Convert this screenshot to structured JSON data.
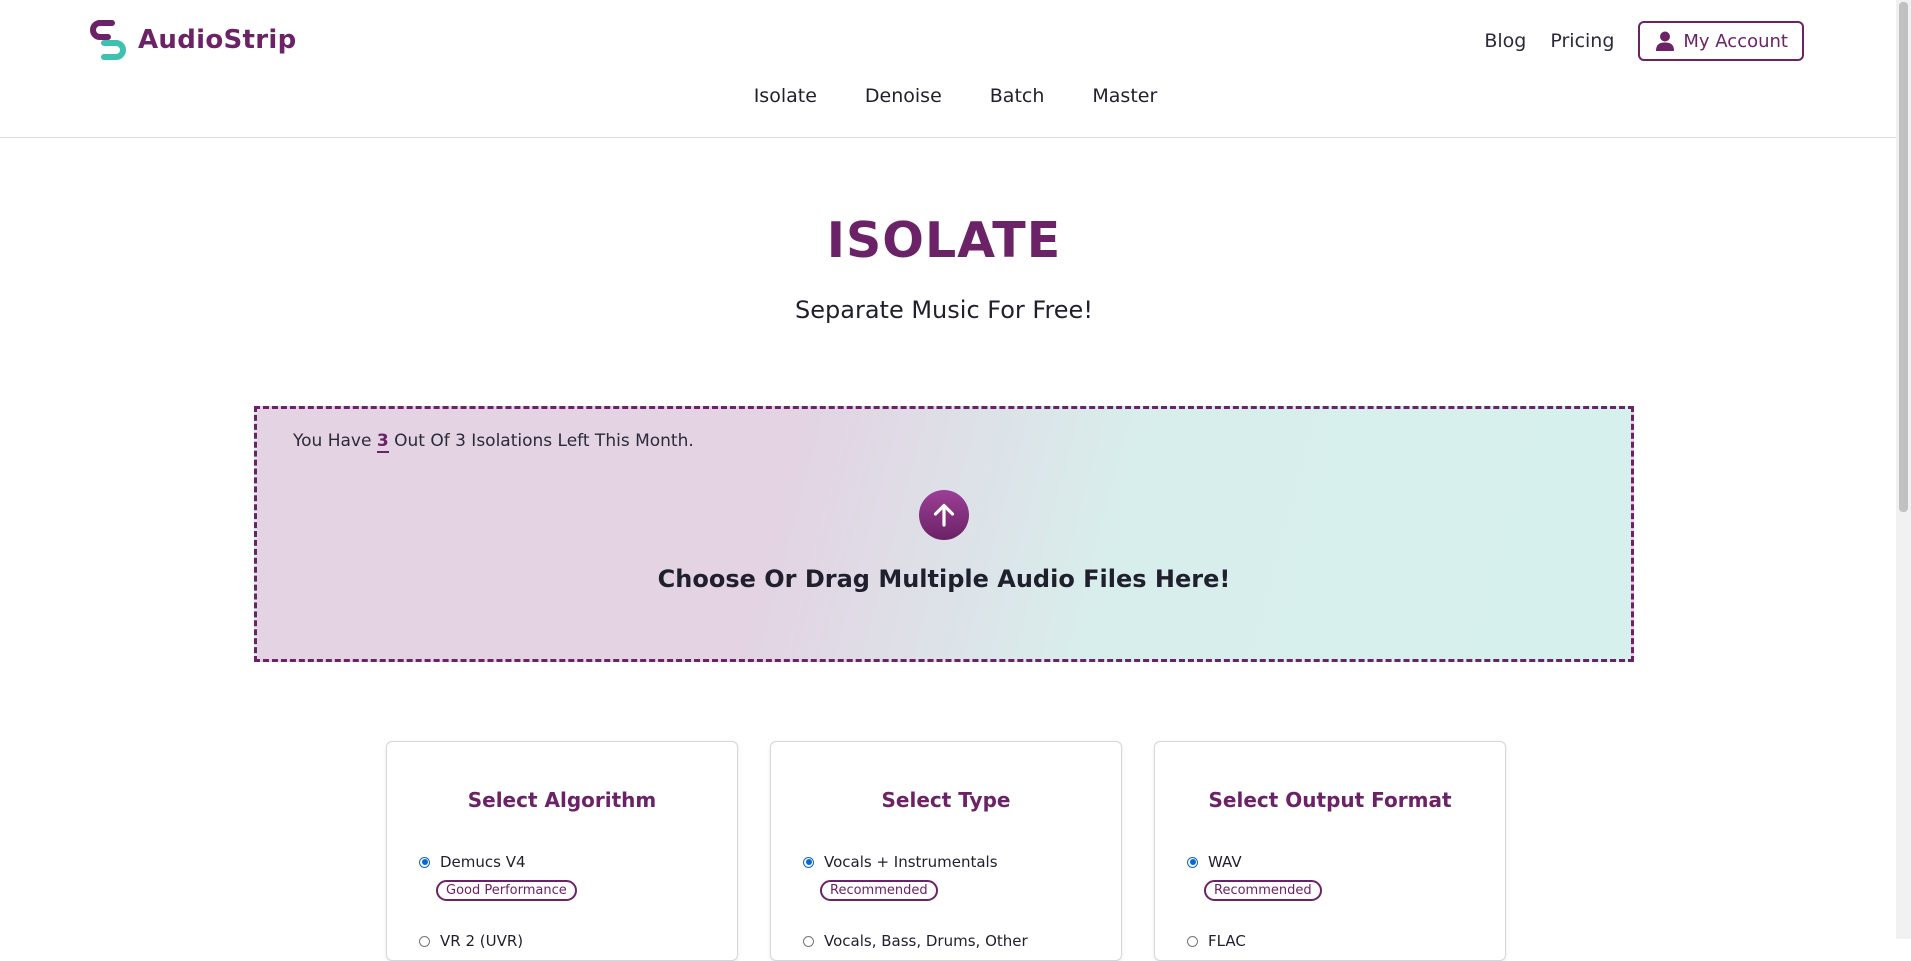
{
  "brand": {
    "name": "AudioStrip",
    "colors": {
      "primary": "#6b2266",
      "accent": "#3fc1b0"
    }
  },
  "top_nav": {
    "blog": "Blog",
    "pricing": "Pricing",
    "account": "My Account"
  },
  "sub_nav": [
    "Isolate",
    "Denoise",
    "Batch",
    "Master"
  ],
  "hero": {
    "title": "ISOLATE",
    "subtitle": "Separate Music For Free!"
  },
  "dropzone": {
    "quota_prefix": "You Have",
    "quota_remaining": "3",
    "quota_suffix": "Out Of 3 Isolations Left This Month.",
    "upload_icon": "arrow-up-icon",
    "prompt": "Choose Or Drag Multiple Audio Files Here!"
  },
  "cards": [
    {
      "title": "Select Algorithm",
      "selected_option": "Demucs V4",
      "badge": "Good Performance",
      "next_option": "VR 2 (UVR)"
    },
    {
      "title": "Select Type",
      "selected_option": "Vocals + Instrumentals",
      "badge": "Recommended",
      "next_option": "Vocals, Bass, Drums, Other"
    },
    {
      "title": "Select Output Format",
      "selected_option": "WAV",
      "badge": "Recommended",
      "next_option": "FLAC"
    }
  ]
}
